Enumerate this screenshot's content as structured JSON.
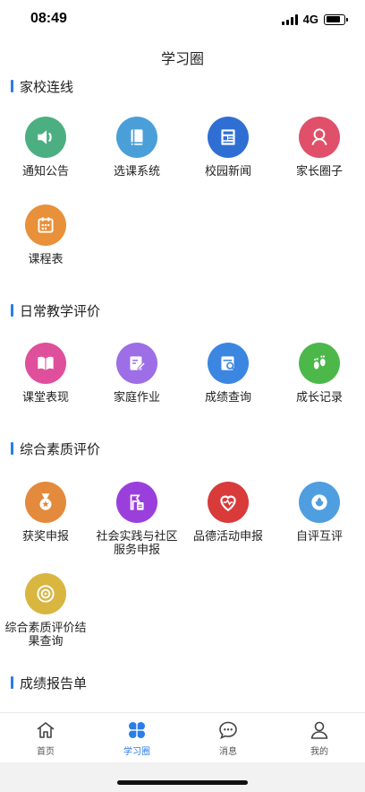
{
  "status": {
    "time": "08:49",
    "network": "4G"
  },
  "nav": {
    "title": "学习圈"
  },
  "sections": [
    {
      "title": "家校连线",
      "items": [
        {
          "label": "通知公告",
          "icon": "speaker-icon",
          "color": "#4caf82"
        },
        {
          "label": "选课系统",
          "icon": "book-icon",
          "color": "#4a9fd8"
        },
        {
          "label": "校园新闻",
          "icon": "newspaper-icon",
          "color": "#2f6fd4"
        },
        {
          "label": "家长圈子",
          "icon": "parent-icon",
          "color": "#e0506a"
        },
        {
          "label": "课程表",
          "icon": "calendar-icon",
          "color": "#e8903a"
        }
      ]
    },
    {
      "title": "日常教学评价",
      "items": [
        {
          "label": "课堂表现",
          "icon": "open-book-icon",
          "color": "#e04f9c"
        },
        {
          "label": "家庭作业",
          "icon": "edit-icon",
          "color": "#9d6ee6"
        },
        {
          "label": "成绩查询",
          "icon": "search-doc-icon",
          "color": "#3b86e0"
        },
        {
          "label": "成长记录",
          "icon": "footprint-icon",
          "color": "#4cb84a"
        }
      ]
    },
    {
      "title": "综合素质评价",
      "items": [
        {
          "label": "获奖申报",
          "icon": "medal-icon",
          "color": "#e38a3c"
        },
        {
          "label": "社会实践与社区\n服务申报",
          "icon": "flag-doc-icon",
          "color": "#9b3fdc"
        },
        {
          "label": "品德活动申报",
          "icon": "heart-icon",
          "color": "#d93a3a"
        },
        {
          "label": "自评互评",
          "icon": "lotus-icon",
          "color": "#4e9ee0"
        },
        {
          "label": "综合素质评价结\n果查询",
          "icon": "target-icon",
          "color": "#d8b640"
        }
      ]
    },
    {
      "title": "成绩报告单",
      "items": []
    }
  ],
  "tabs": [
    {
      "label": "首页",
      "icon": "home-icon",
      "active": false
    },
    {
      "label": "学习圈",
      "icon": "clover-icon",
      "active": true
    },
    {
      "label": "消息",
      "icon": "chat-icon",
      "active": false
    },
    {
      "label": "我的",
      "icon": "user-icon",
      "active": false
    }
  ],
  "colors": {
    "accent": "#2b7de9"
  }
}
